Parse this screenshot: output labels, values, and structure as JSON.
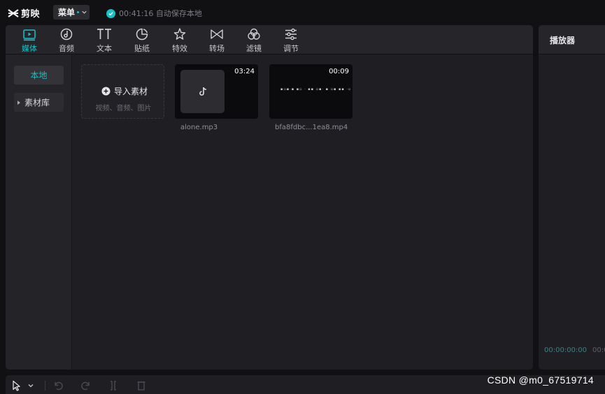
{
  "app": {
    "name": "剪映"
  },
  "titlebar": {
    "menu_label": "菜单",
    "autosave_text": "00:41:16 自动保存本地"
  },
  "tabs": [
    {
      "label": "媒体",
      "icon": "media-icon",
      "active": true
    },
    {
      "label": "音频",
      "icon": "audio-icon",
      "active": false
    },
    {
      "label": "文本",
      "icon": "text-icon",
      "active": false
    },
    {
      "label": "贴纸",
      "icon": "sticker-icon",
      "active": false
    },
    {
      "label": "特效",
      "icon": "effects-icon",
      "active": false
    },
    {
      "label": "转场",
      "icon": "transition-icon",
      "active": false
    },
    {
      "label": "滤镜",
      "icon": "filter-icon",
      "active": false
    },
    {
      "label": "调节",
      "icon": "adjust-icon",
      "active": false
    }
  ],
  "side_nav": {
    "local": "本地",
    "library": "素材库"
  },
  "import_card": {
    "label": "导入素材",
    "subtitle": "视频、音频、图片"
  },
  "clips": [
    {
      "name": "alone.mp3",
      "duration": "03:24",
      "kind": "audio"
    },
    {
      "name": "bfa8fdbc...1ea8.mp4",
      "duration": "00:09",
      "kind": "video"
    }
  ],
  "player": {
    "title": "播放器",
    "current_time": "00:00:00:00",
    "total_time": "00:0"
  },
  "watermark": "CSDN @m0_67519714",
  "colors": {
    "accent": "#19c0c8",
    "background": "#111114",
    "panel": "#1f1f23"
  }
}
